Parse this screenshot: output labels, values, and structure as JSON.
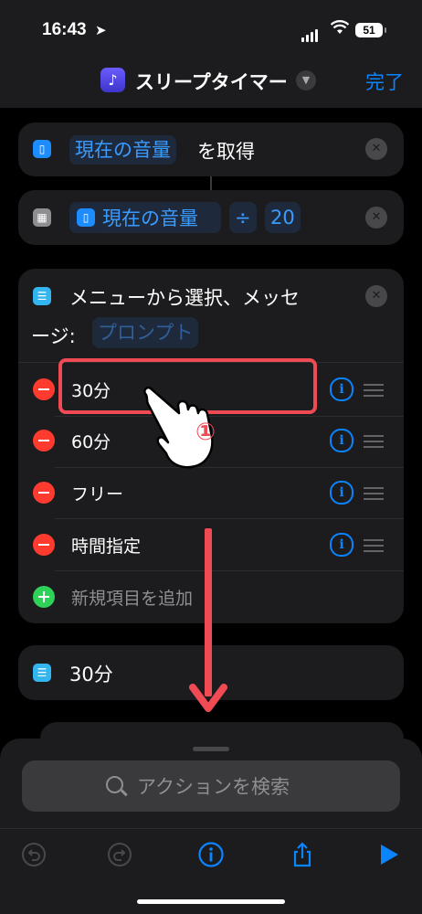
{
  "status": {
    "time": "16:43",
    "battery": "51"
  },
  "nav": {
    "title": "スリープタイマー",
    "done": "完了"
  },
  "actions": {
    "get_volume": {
      "var": "現在の音量",
      "suffix": "を取得"
    },
    "calc": {
      "var": "現在の音量",
      "op": "÷",
      "num": "20"
    },
    "menu": {
      "line1": "メニューから選択、メッセ",
      "line2": "ージ:",
      "prompt": "プロンプト",
      "items": [
        "30分",
        "60分",
        "フリー",
        "時間指定"
      ],
      "add_label": "新規項目を追加"
    },
    "case": {
      "label": "30分"
    }
  },
  "annotation": {
    "step": "①"
  },
  "sheet": {
    "search_placeholder": "アクションを検索"
  },
  "colors": {
    "accent": "#0a84ff",
    "annotation": "#f04b55",
    "delete": "#ff3b30",
    "add": "#30d158"
  }
}
